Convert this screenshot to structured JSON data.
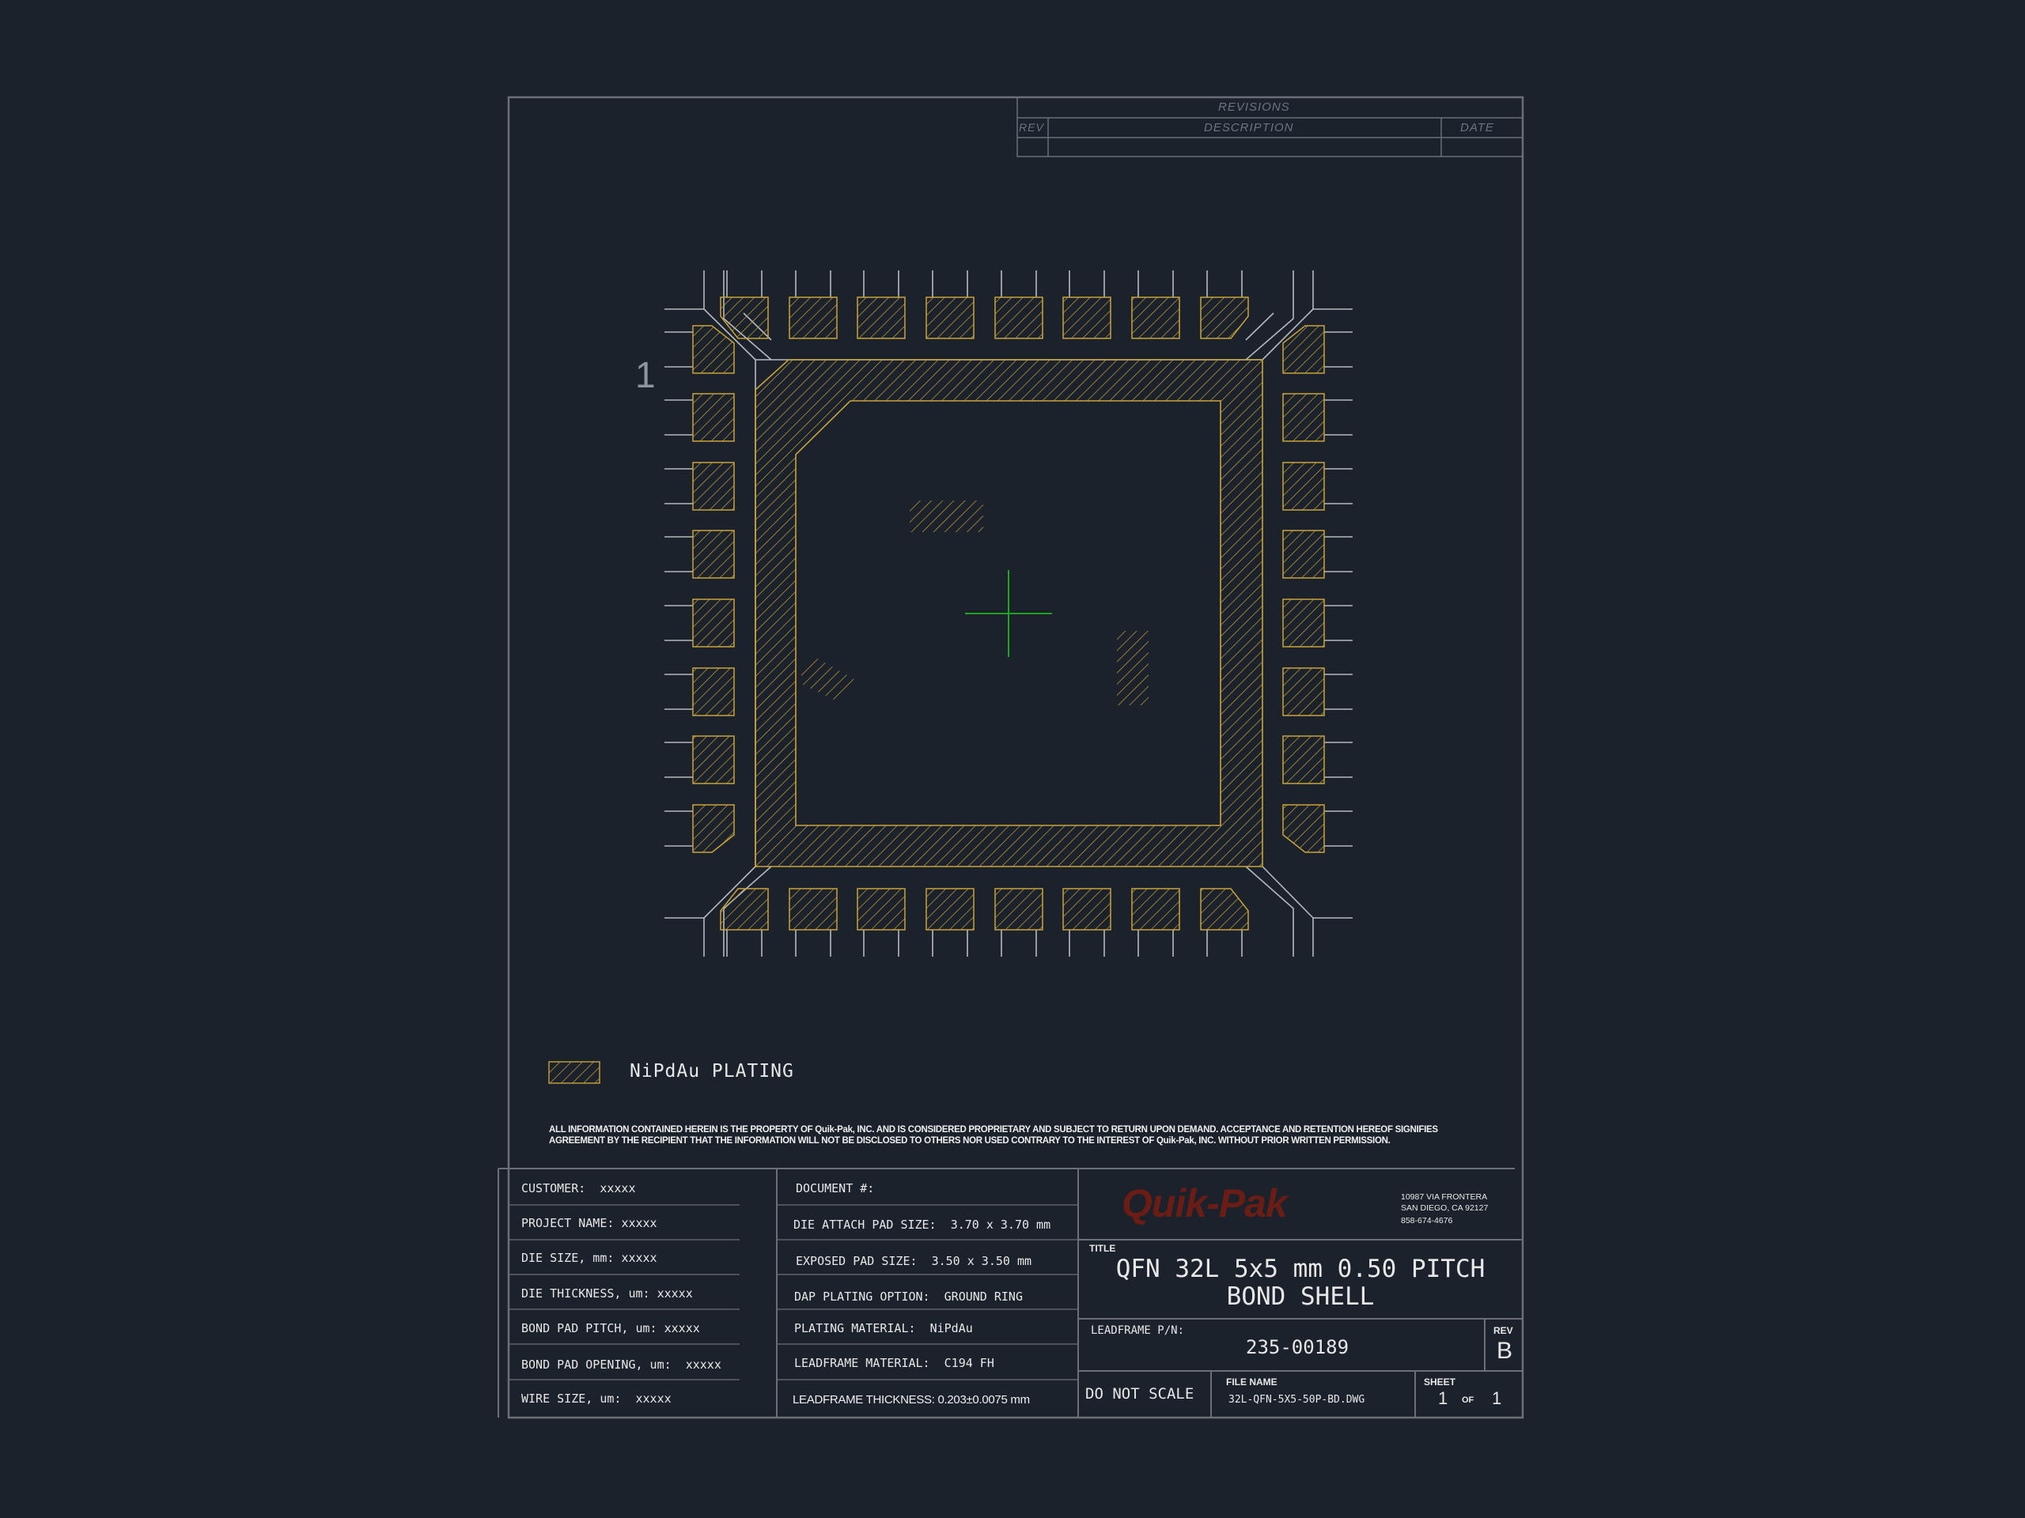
{
  "revisions": {
    "header": "REVISIONS",
    "col_rev": "REV",
    "col_description": "DESCRIPTION",
    "col_date": "DATE"
  },
  "drawing": {
    "pin1_label": "1",
    "colors": {
      "background": "#1b222c",
      "border": "#6b6f76",
      "leadframe_lines": "#b5b9bf",
      "plating": "#c9a23a",
      "center_mark": "#1fb51f"
    }
  },
  "legend": {
    "label": "NiPdAu PLATING"
  },
  "disclaimer": {
    "line1": "ALL INFORMATION CONTAINED HEREIN IS THE PROPERTY OF Quik-Pak, INC. AND IS CONSIDERED PROPRIETARY AND SUBJECT TO RETURN UPON DEMAND. ACCEPTANCE AND RETENTION HEREOF SIGNIFIES",
    "line2": "AGREEMENT BY THE RECIPIENT THAT THE INFORMATION WILL NOT BE DISCLOSED TO OTHERS NOR USED CONTRARY TO THE INTEREST OF Quik-Pak, INC. WITHOUT PRIOR WRITTEN PERMISSION."
  },
  "left_fields": [
    {
      "label": "CUSTOMER:  ",
      "value": "xxxxx"
    },
    {
      "label": "PROJECT NAME: ",
      "value": "xxxxx"
    },
    {
      "label": "DIE SIZE, mm: ",
      "value": "xxxxx"
    },
    {
      "label": "DIE THICKNESS, um: ",
      "value": "xxxxx"
    },
    {
      "label": "BOND PAD PITCH, um: ",
      "value": "xxxxx"
    },
    {
      "label": "BOND PAD OPENING, um:  ",
      "value": "xxxxx"
    },
    {
      "label": "WIRE SIZE, um:  ",
      "value": "xxxxx"
    }
  ],
  "mid_fields": [
    {
      "label": "DOCUMENT #:",
      "value": ""
    },
    {
      "label": "DIE ATTACH PAD SIZE:  ",
      "value": "3.70 x 3.70 mm"
    },
    {
      "label": "EXPOSED PAD SIZE:  ",
      "value": "3.50 x 3.50 mm"
    },
    {
      "label": "DAP PLATING OPTION:  ",
      "value": "GROUND RING"
    },
    {
      "label": "PLATING MATERIAL:  ",
      "value": "NiPdAu"
    },
    {
      "label": "LEADFRAME MATERIAL:  ",
      "value": "C194 FH"
    }
  ],
  "leadframe_thickness": "LEADFRAME THICKNESS: 0.203±0.0075 mm",
  "title_block": {
    "company_logo": "Quik-Pak",
    "address_line1": "10987 VIA FRONTERA",
    "address_line2": "SAN DIEGO, CA 92127",
    "phone": "858-674-4676",
    "title_label": "TITLE",
    "title_line1": "QFN 32L 5x5 mm 0.50 PITCH",
    "title_line2": "BOND SHELL",
    "leadframe_pn_label": "LEADFRAME P/N:",
    "leadframe_pn": "235-00189",
    "rev_label": "REV",
    "rev": "B",
    "do_not_scale": "DO NOT SCALE",
    "file_name_label": "FILE NAME",
    "file_name": "32L-QFN-5X5-50P-BD.DWG",
    "sheet_label": "SHEET",
    "sheet_number": "1",
    "sheet_of": "OF",
    "sheet_total": "1"
  }
}
